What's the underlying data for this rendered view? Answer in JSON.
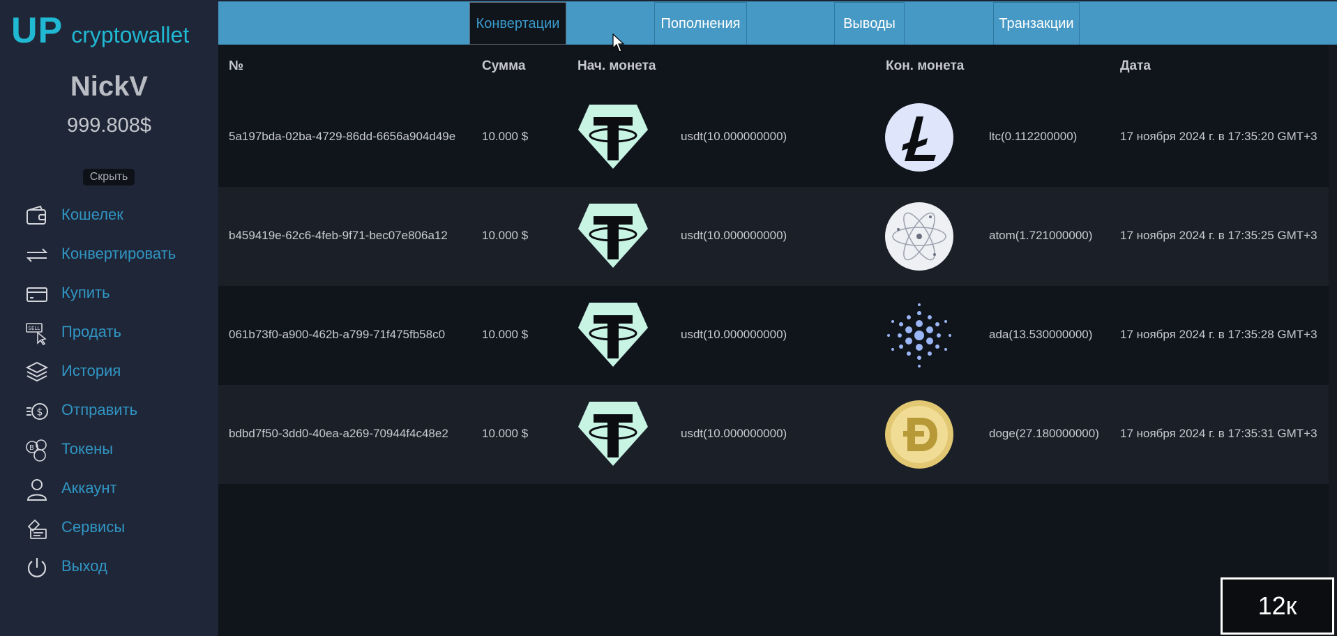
{
  "brand": {
    "logo_main": "UP",
    "logo_sub": "cryptowallet",
    "accent": "#20b8d2"
  },
  "user": {
    "name": "NickV",
    "balance": "999.808$",
    "hide_label": "Скрыть"
  },
  "nav": [
    {
      "label": "Кошелек",
      "icon": "wallet-icon"
    },
    {
      "label": "Конвертировать",
      "icon": "convert-icon"
    },
    {
      "label": "Купить",
      "icon": "card-icon"
    },
    {
      "label": "Продать",
      "icon": "sell-icon"
    },
    {
      "label": "История",
      "icon": "layers-icon"
    },
    {
      "label": "Отправить",
      "icon": "send-dollar-icon"
    },
    {
      "label": "Токены",
      "icon": "tokens-icon"
    },
    {
      "label": "Аккаунт",
      "icon": "user-icon"
    },
    {
      "label": "Сервисы",
      "icon": "services-icon"
    },
    {
      "label": "Выход",
      "icon": "power-icon"
    }
  ],
  "tabs": [
    {
      "label": "Конвертации",
      "active": true
    },
    {
      "label": "Пополнения",
      "active": false
    },
    {
      "label": "Выводы",
      "active": false
    },
    {
      "label": "Транзакции",
      "active": false
    }
  ],
  "table": {
    "headers": {
      "id": "№",
      "amount": "Сумма",
      "from_coin": "Нач. монета",
      "to_coin": "Кон. монета",
      "date": "Дата"
    },
    "rows": [
      {
        "id": "5a197bda-02ba-4729-86dd-6656a904d49e",
        "amount": "10.000 $",
        "from_icon": "tether-icon",
        "from_text": "usdt(10.000000000)",
        "to_icon": "litecoin-icon",
        "to_text": "ltc(0.112200000)",
        "date": "17 ноября 2024 г. в 17:35:20 GMT+3"
      },
      {
        "id": "b459419e-62c6-4feb-9f71-bec07e806a12",
        "amount": "10.000 $",
        "from_icon": "tether-icon",
        "from_text": "usdt(10.000000000)",
        "to_icon": "cosmos-atom-icon",
        "to_text": "atom(1.721000000)",
        "date": "17 ноября 2024 г. в 17:35:25 GMT+3"
      },
      {
        "id": "061b73f0-a900-462b-a799-71f475fb58c0",
        "amount": "10.000 $",
        "from_icon": "tether-icon",
        "from_text": "usdt(10.000000000)",
        "to_icon": "cardano-icon",
        "to_text": "ada(13.530000000)",
        "date": "17 ноября 2024 г. в 17:35:28 GMT+3"
      },
      {
        "id": "bdbd7f50-3dd0-40ea-a269-70944f4c48e2",
        "amount": "10.000 $",
        "from_icon": "tether-icon",
        "from_text": "usdt(10.000000000)",
        "to_icon": "dogecoin-icon",
        "to_text": "doge(27.180000000)",
        "date": "17 ноября 2024 г. в 17:35:31 GMT+3"
      }
    ]
  },
  "overlay_badge": "12к"
}
